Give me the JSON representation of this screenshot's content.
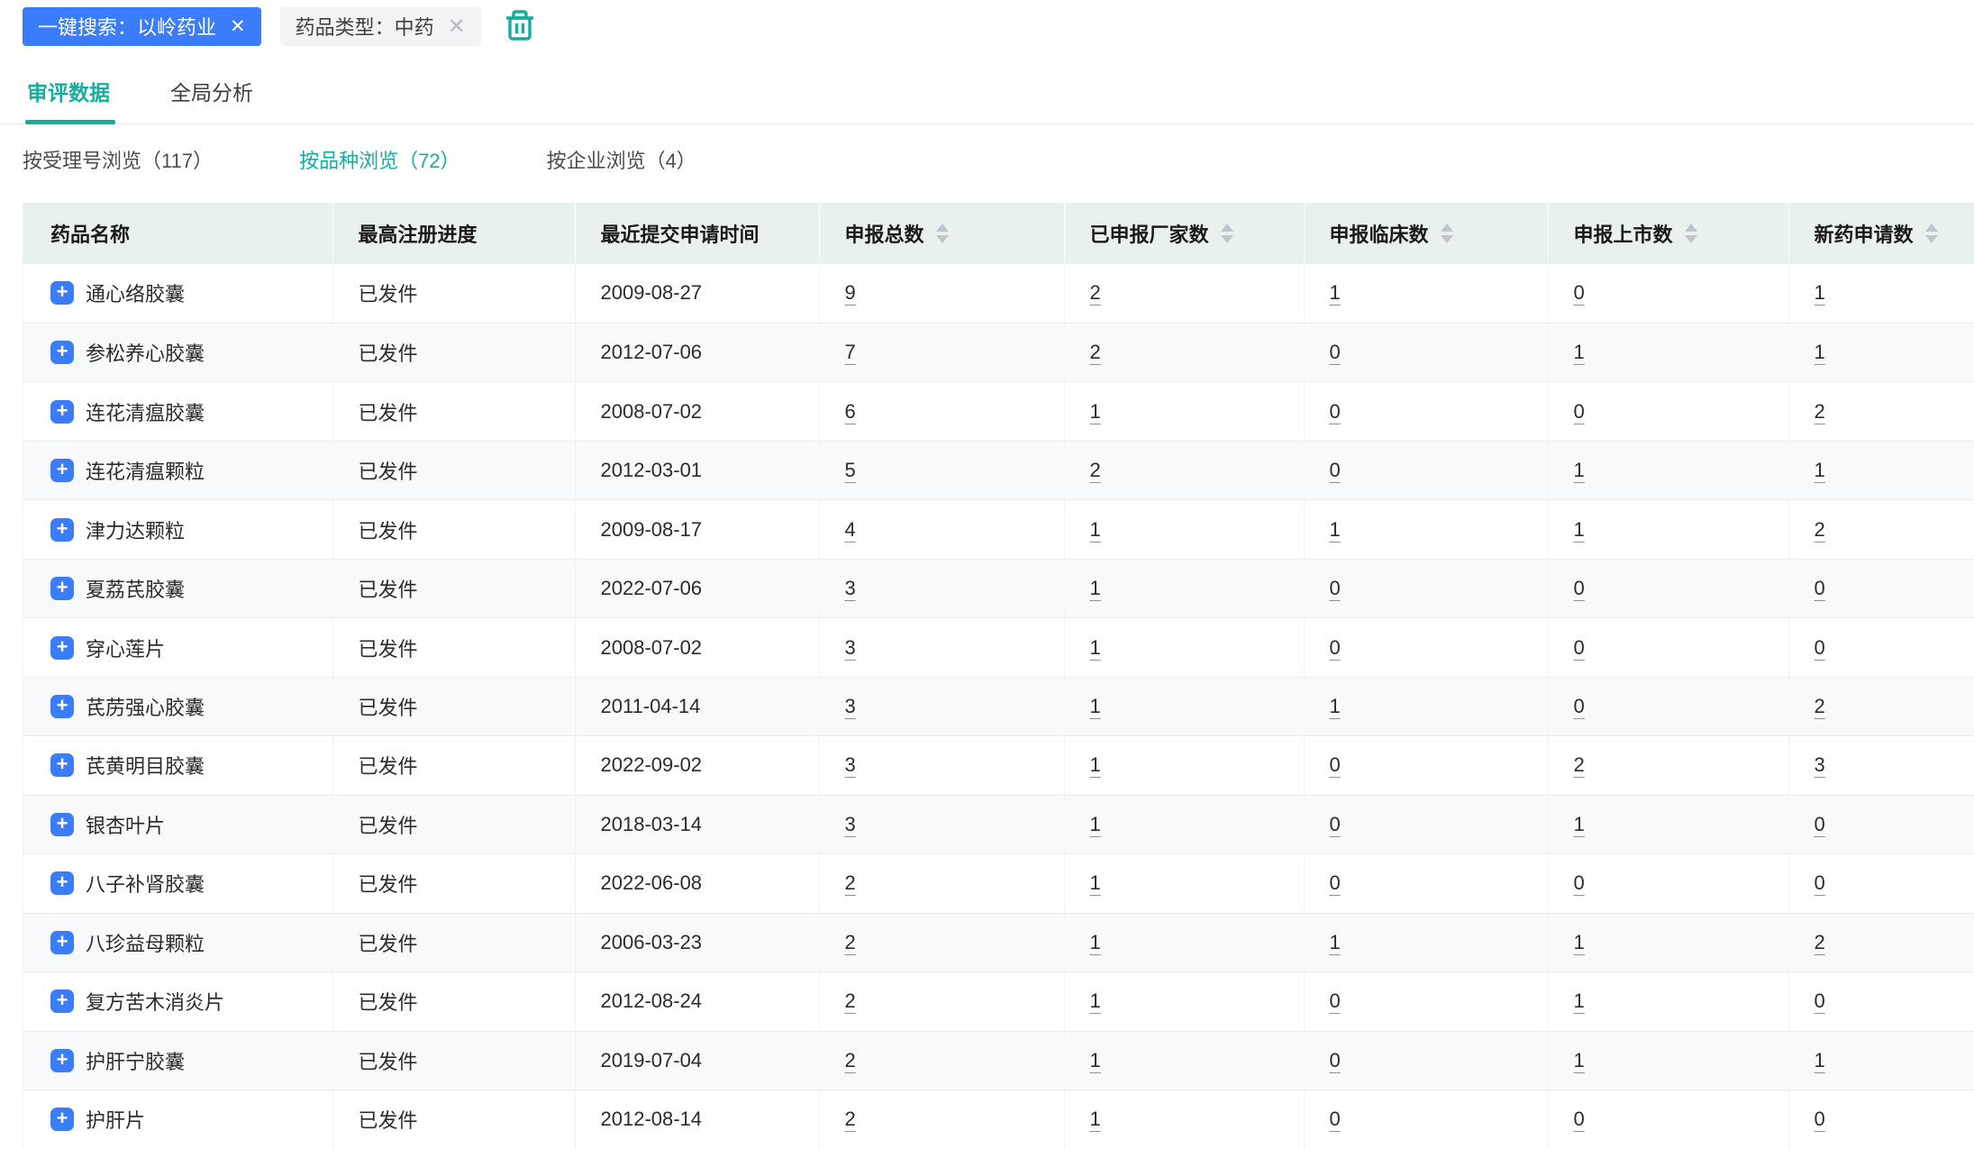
{
  "filter_bar": {
    "search_tag": {
      "text": "一键搜索：以岭药业",
      "close": "✕"
    },
    "type_tag": {
      "text": "药品类型：中药",
      "close": "✕"
    },
    "trash_icon": "trash-icon"
  },
  "tabs": [
    {
      "label": "审评数据",
      "active": true
    },
    {
      "label": "全局分析",
      "active": false
    }
  ],
  "subtabs": [
    {
      "label": "按受理号浏览（117）",
      "active": false
    },
    {
      "label": "按品种浏览（72）",
      "active": true
    },
    {
      "label": "按企业浏览（4）",
      "active": false
    }
  ],
  "table": {
    "columns": [
      {
        "label": "药品名称",
        "sortable": false
      },
      {
        "label": "最高注册进度",
        "sortable": false
      },
      {
        "label": "最近提交申请时间",
        "sortable": false
      },
      {
        "label": "申报总数",
        "sortable": true
      },
      {
        "label": "已申报厂家数",
        "sortable": true
      },
      {
        "label": "申报临床数",
        "sortable": true
      },
      {
        "label": "申报上市数",
        "sortable": true
      },
      {
        "label": "新药申请数",
        "sortable": true
      }
    ],
    "rows": [
      {
        "name": "通心络胶囊",
        "status": "已发件",
        "date": "2009-08-27",
        "total": "9",
        "manufacturers": "2",
        "clinical": "1",
        "market": "0",
        "new_drug": "1"
      },
      {
        "name": "参松养心胶囊",
        "status": "已发件",
        "date": "2012-07-06",
        "total": "7",
        "manufacturers": "2",
        "clinical": "0",
        "market": "1",
        "new_drug": "1"
      },
      {
        "name": "连花清瘟胶囊",
        "status": "已发件",
        "date": "2008-07-02",
        "total": "6",
        "manufacturers": "1",
        "clinical": "0",
        "market": "0",
        "new_drug": "2"
      },
      {
        "name": "连花清瘟颗粒",
        "status": "已发件",
        "date": "2012-03-01",
        "total": "5",
        "manufacturers": "2",
        "clinical": "0",
        "market": "1",
        "new_drug": "1"
      },
      {
        "name": "津力达颗粒",
        "status": "已发件",
        "date": "2009-08-17",
        "total": "4",
        "manufacturers": "1",
        "clinical": "1",
        "market": "1",
        "new_drug": "2"
      },
      {
        "name": "夏荔芪胶囊",
        "status": "已发件",
        "date": "2022-07-06",
        "total": "3",
        "manufacturers": "1",
        "clinical": "0",
        "market": "0",
        "new_drug": "0"
      },
      {
        "name": "穿心莲片",
        "status": "已发件",
        "date": "2008-07-02",
        "total": "3",
        "manufacturers": "1",
        "clinical": "0",
        "market": "0",
        "new_drug": "0"
      },
      {
        "name": "芪苈强心胶囊",
        "status": "已发件",
        "date": "2011-04-14",
        "total": "3",
        "manufacturers": "1",
        "clinical": "1",
        "market": "0",
        "new_drug": "2"
      },
      {
        "name": "芪黄明目胶囊",
        "status": "已发件",
        "date": "2022-09-02",
        "total": "3",
        "manufacturers": "1",
        "clinical": "0",
        "market": "2",
        "new_drug": "3"
      },
      {
        "name": "银杏叶片",
        "status": "已发件",
        "date": "2018-03-14",
        "total": "3",
        "manufacturers": "1",
        "clinical": "0",
        "market": "1",
        "new_drug": "0"
      },
      {
        "name": "八子补肾胶囊",
        "status": "已发件",
        "date": "2022-06-08",
        "total": "2",
        "manufacturers": "1",
        "clinical": "0",
        "market": "0",
        "new_drug": "0"
      },
      {
        "name": "八珍益母颗粒",
        "status": "已发件",
        "date": "2006-03-23",
        "total": "2",
        "manufacturers": "1",
        "clinical": "1",
        "market": "1",
        "new_drug": "2"
      },
      {
        "name": "复方苦木消炎片",
        "status": "已发件",
        "date": "2012-08-24",
        "total": "2",
        "manufacturers": "1",
        "clinical": "0",
        "market": "1",
        "new_drug": "0"
      },
      {
        "name": "护肝宁胶囊",
        "status": "已发件",
        "date": "2019-07-04",
        "total": "2",
        "manufacturers": "1",
        "clinical": "0",
        "market": "1",
        "new_drug": "1"
      },
      {
        "name": "护肝片",
        "status": "已发件",
        "date": "2012-08-14",
        "total": "2",
        "manufacturers": "1",
        "clinical": "0",
        "market": "0",
        "new_drug": "0"
      }
    ],
    "expand_icon": "+"
  },
  "colors": {
    "accent_teal": "#15ae9d",
    "tag_blue": "#3b7cfa",
    "header_bg": "#e9f1ef",
    "stripe_bg": "#f8f9fb"
  }
}
